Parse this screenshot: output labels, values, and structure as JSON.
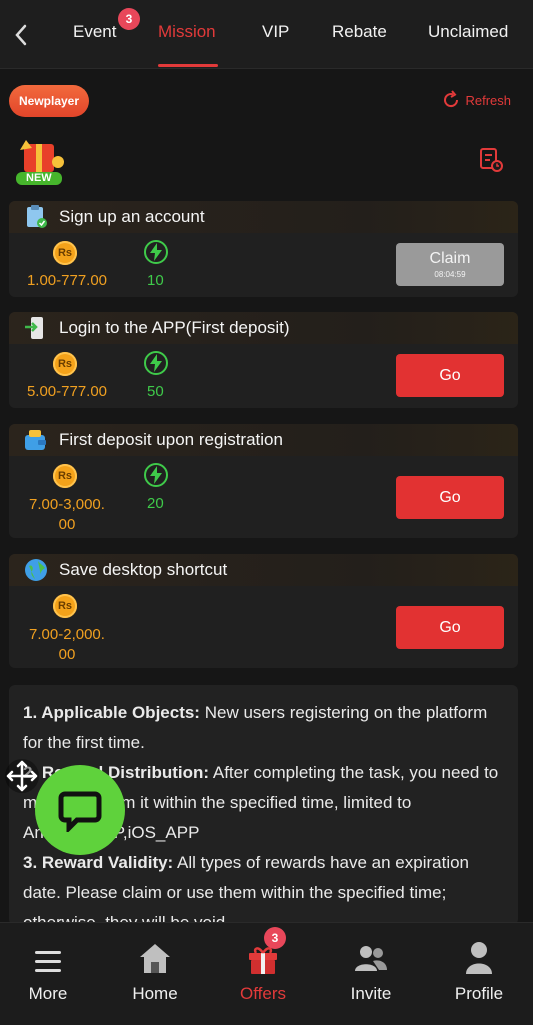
{
  "tabs": [
    {
      "label": "Event",
      "badge": "3"
    },
    {
      "label": "Mission"
    },
    {
      "label": "VIP"
    },
    {
      "label": "Rebate"
    },
    {
      "label": "Unclaimed"
    }
  ],
  "header": {
    "chip_label": "Newplayer",
    "refresh_label": "Refresh",
    "new_label": "NEW"
  },
  "missions": [
    {
      "title": "Sign up an account",
      "currency": "Rs",
      "amount": "1.00-777.00",
      "points": "10",
      "button": "Claim",
      "timer": "08:04:59"
    },
    {
      "title": "Login to the APP(First deposit)",
      "currency": "Rs",
      "amount": "5.00-777.00",
      "points": "50",
      "button": "Go"
    },
    {
      "title": "First deposit upon registration",
      "currency": "Rs",
      "amount_line1": "7.00-3,000.",
      "amount_line2": "00",
      "points": "20",
      "button": "Go"
    },
    {
      "title": "Save desktop shortcut",
      "currency": "Rs",
      "amount_line1": "7.00-2,000.",
      "amount_line2": "00",
      "button": "Go"
    }
  ],
  "rules": {
    "r1_head": "1. Applicable Objects:",
    "r1_text": " New users registering on the platform for the first time.",
    "r2_head": "2. Reward Distribution:",
    "r2_text": " After completing the task, you need to manually claim it within the specified time, limited to Android_APP,iOS_APP",
    "r3_head": "3. Reward Validity:",
    "r3_text": " All types of rewards have an expiration date. Please claim or use them within the specified time; otherwise, they will be void."
  },
  "nav": [
    {
      "label": "More"
    },
    {
      "label": "Home"
    },
    {
      "label": "Offers",
      "badge": "3"
    },
    {
      "label": "Invite"
    },
    {
      "label": "Profile"
    }
  ],
  "colors": {
    "accent": "#e23a3a",
    "coin": "#f4a21a",
    "points": "#3fca4a",
    "chat": "#5fd23c"
  }
}
